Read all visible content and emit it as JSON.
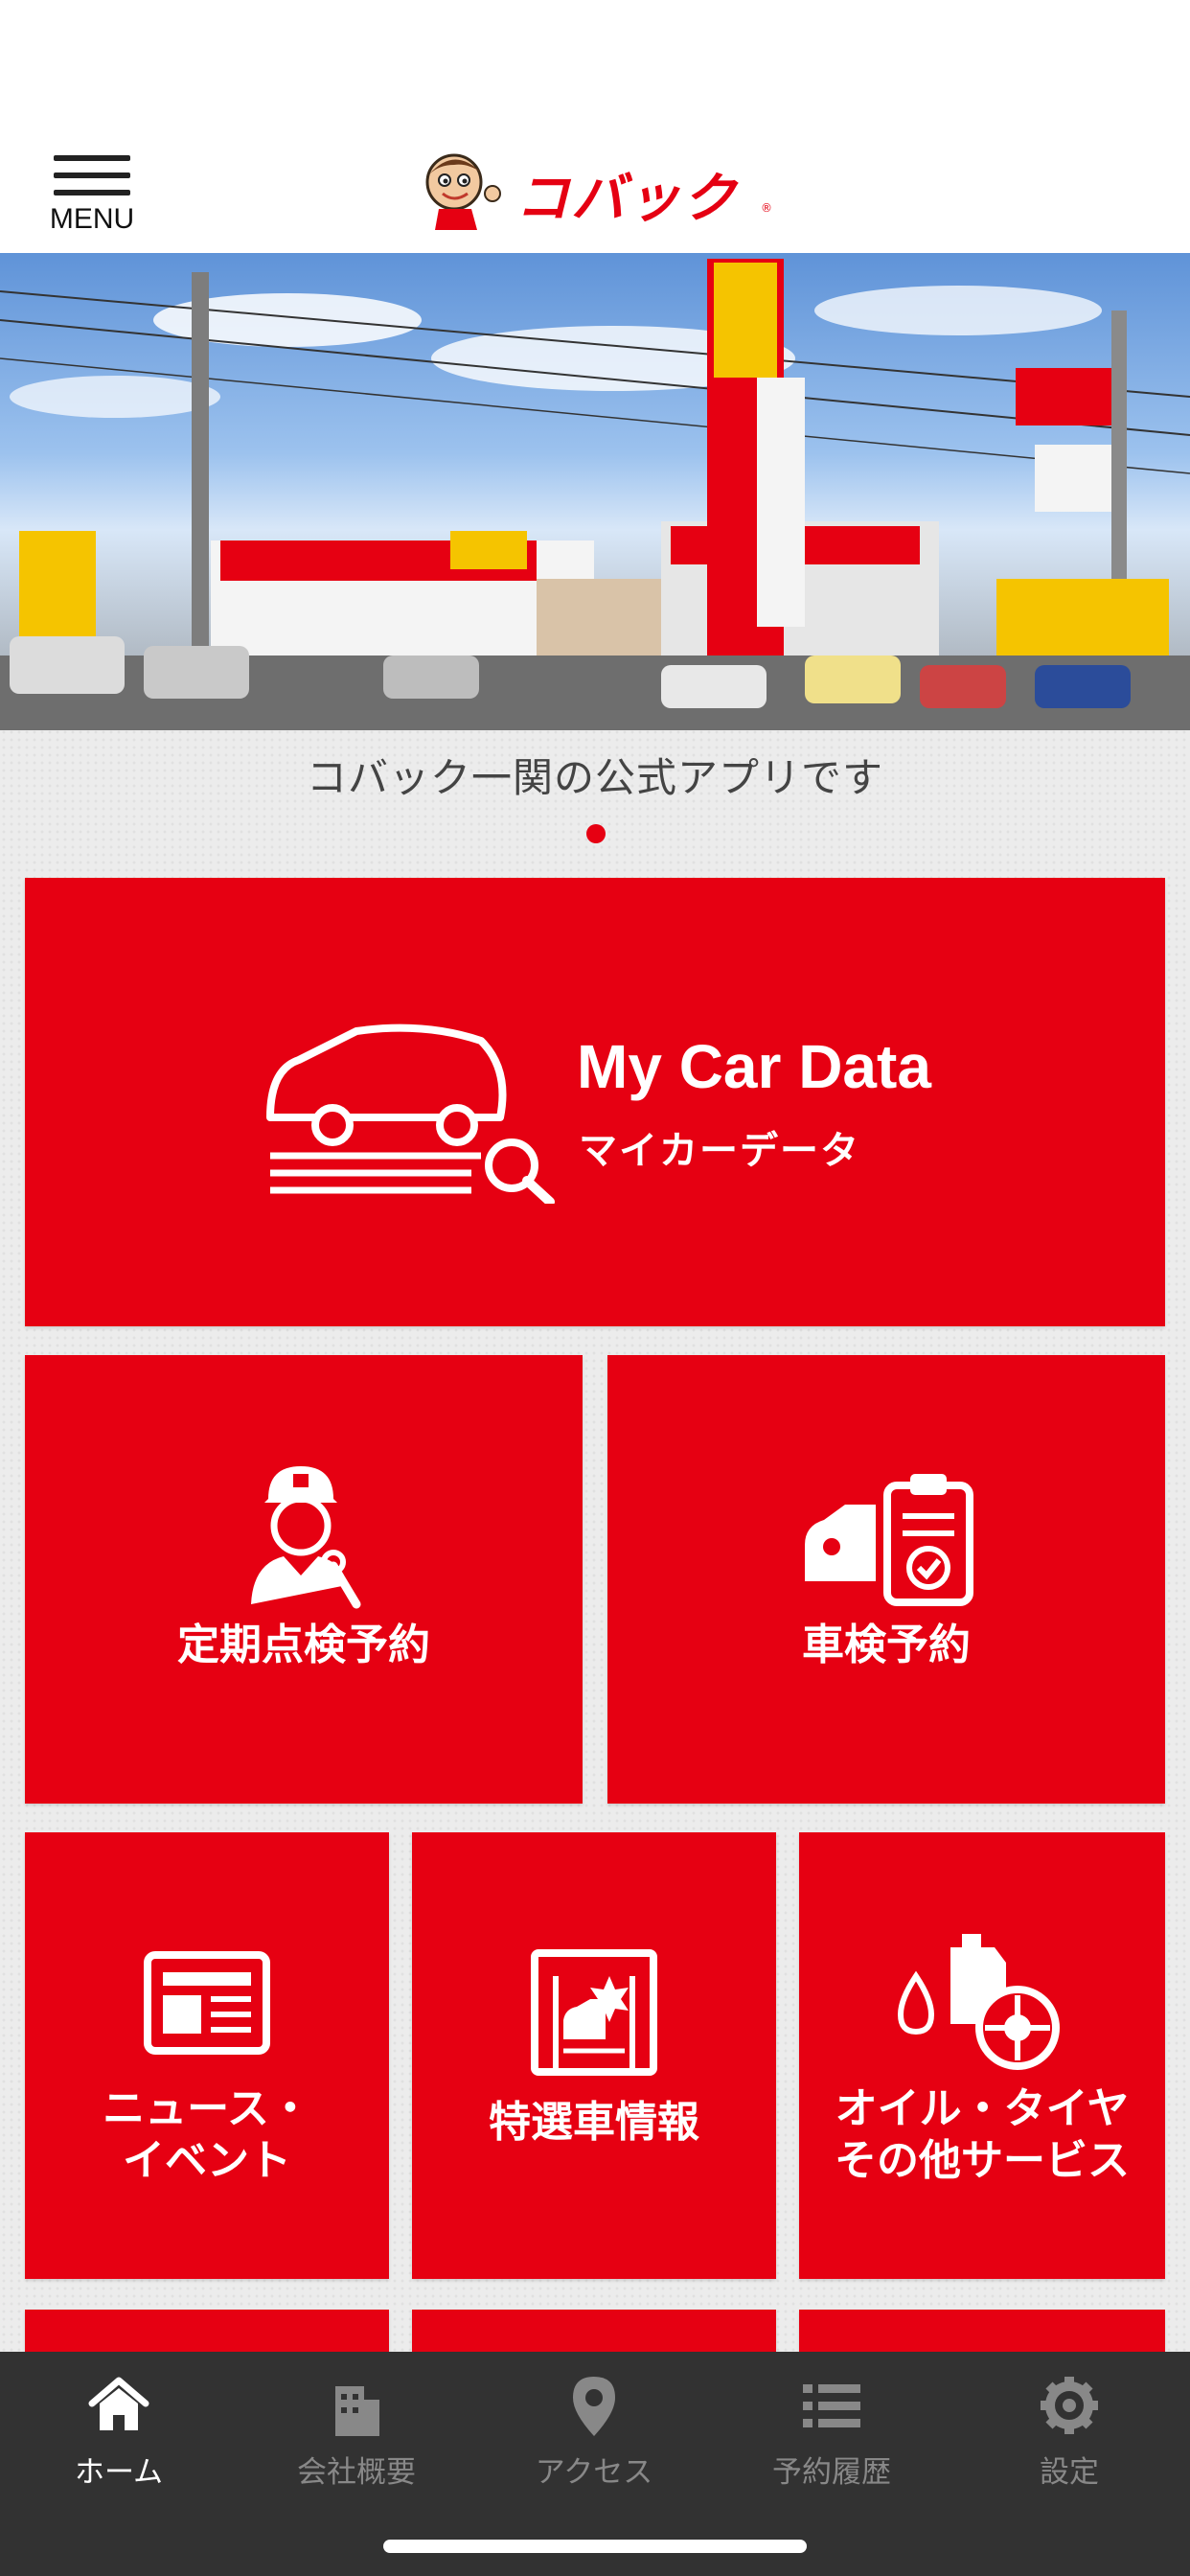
{
  "header": {
    "menu_label": "MENU",
    "logo_text": "コバック"
  },
  "banner": {
    "tagline": "コバック一関の公式アプリです",
    "page_indicator": {
      "current": 1,
      "total": 1
    }
  },
  "tiles": {
    "my_car_data": {
      "title": "My Car Data",
      "subtitle": "マイカーデータ"
    },
    "periodic_inspection": {
      "label": "定期点検予約"
    },
    "shaken": {
      "label": "車検予約"
    },
    "news": {
      "label": "ニュース・\nイベント"
    },
    "featured_cars": {
      "label": "特選車情報"
    },
    "services": {
      "label": "オイル・タイヤ\nその他サービス"
    }
  },
  "tabbar": {
    "items": [
      {
        "label": "ホーム",
        "icon": "home-icon",
        "active": true
      },
      {
        "label": "会社概要",
        "icon": "building-icon",
        "active": false
      },
      {
        "label": "アクセス",
        "icon": "map-pin-icon",
        "active": false
      },
      {
        "label": "予約履歴",
        "icon": "list-icon",
        "active": false
      },
      {
        "label": "設定",
        "icon": "gear-icon",
        "active": false
      }
    ]
  },
  "colors": {
    "brand_red": "#e60012",
    "tabbar_bg": "#323232",
    "tab_inactive": "#888888",
    "tab_active": "#ffffff"
  }
}
